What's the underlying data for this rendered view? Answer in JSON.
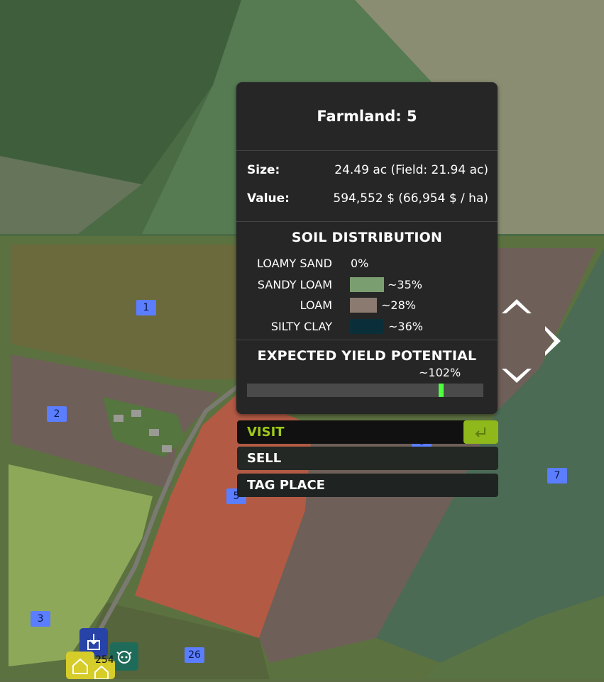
{
  "farmland": {
    "title": "Farmland: 5",
    "size_label": "Size:",
    "size_value": "24.49 ac (Field: 21.94 ac)",
    "value_label": "Value:",
    "value_value": "594,552 $ (66,954 $ / ha)"
  },
  "soil": {
    "title": "SOIL DISTRIBUTION",
    "items": [
      {
        "name": "LOAMY SAND",
        "percent": "0%",
        "color": null
      },
      {
        "name": "SANDY LOAM",
        "percent": "~35%",
        "color": "#7a9e70"
      },
      {
        "name": "LOAM",
        "percent": "~28%",
        "color": "#8a7a70"
      },
      {
        "name": "SILTY CLAY",
        "percent": "~36%",
        "color": "#0b2f3a"
      }
    ]
  },
  "yield": {
    "title": "EXPECTED YIELD POTENTIAL",
    "percent_label": "~102%",
    "marker_fraction": 0.81,
    "bar_color": "#4a4a4a",
    "marker_color": "#4dff3e"
  },
  "menu": {
    "visit": "VISIT",
    "sell": "SELL",
    "tag_place": "TAG PLACE",
    "enter_key_icon": "enter-key-icon"
  },
  "map": {
    "field_labels": [
      "1",
      "2",
      "3",
      "5",
      "6",
      "7",
      "26"
    ],
    "counter": "254",
    "colors": {
      "owned_field": "#b25a44",
      "label_bg": "#5b7dff",
      "accent": "#9ec919"
    }
  }
}
